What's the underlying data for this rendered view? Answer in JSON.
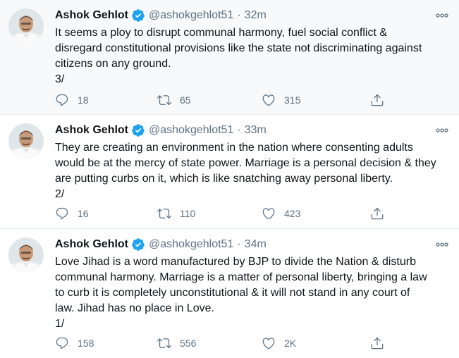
{
  "colors": {
    "text": "#0f1419",
    "muted": "#5b7083",
    "verified": "#1da1f2",
    "divider": "#e6ecf0",
    "highlight_bg": "#f7f9fa"
  },
  "tweets": [
    {
      "author_name": "Ashok Gehlot",
      "handle": "@ashokgehlot51",
      "separator": "·",
      "time": "32m",
      "text": "It seems a ploy to disrupt communal harmony, fuel social conflict & \ndisregard constitutional provisions like the state not discriminating against \ncitizens on any ground.\n3/",
      "replies": "18",
      "retweets": "65",
      "likes": "315",
      "icons": [
        "verified-badge-icon",
        "more-icon",
        "reply-icon",
        "retweet-icon",
        "like-icon",
        "share-icon"
      ]
    },
    {
      "author_name": "Ashok Gehlot",
      "handle": "@ashokgehlot51",
      "separator": "·",
      "time": "33m",
      "text": "They are creating an environment in the nation where consenting adults \nwould be at the mercy of state power. Marriage is a personal decision & they \nare putting curbs on it, which is like snatching away personal liberty.\n2/",
      "replies": "16",
      "retweets": "110",
      "likes": "423",
      "icons": [
        "verified-badge-icon",
        "more-icon",
        "reply-icon",
        "retweet-icon",
        "like-icon",
        "share-icon"
      ]
    },
    {
      "author_name": "Ashok Gehlot",
      "handle": "@ashokgehlot51",
      "separator": "·",
      "time": "34m",
      "text": "Love Jihad is a word manufactured by BJP to divide the Nation & disturb \ncommunal harmony. Marriage is a matter of personal liberty, bringing a law \nto curb it is completely unconstitutional & it will not stand in any court of \nlaw. Jihad has no place in Love.\n1/",
      "replies": "158",
      "retweets": "556",
      "likes": "2K",
      "icons": [
        "verified-badge-icon",
        "more-icon",
        "reply-icon",
        "retweet-icon",
        "like-icon",
        "share-icon"
      ]
    }
  ]
}
